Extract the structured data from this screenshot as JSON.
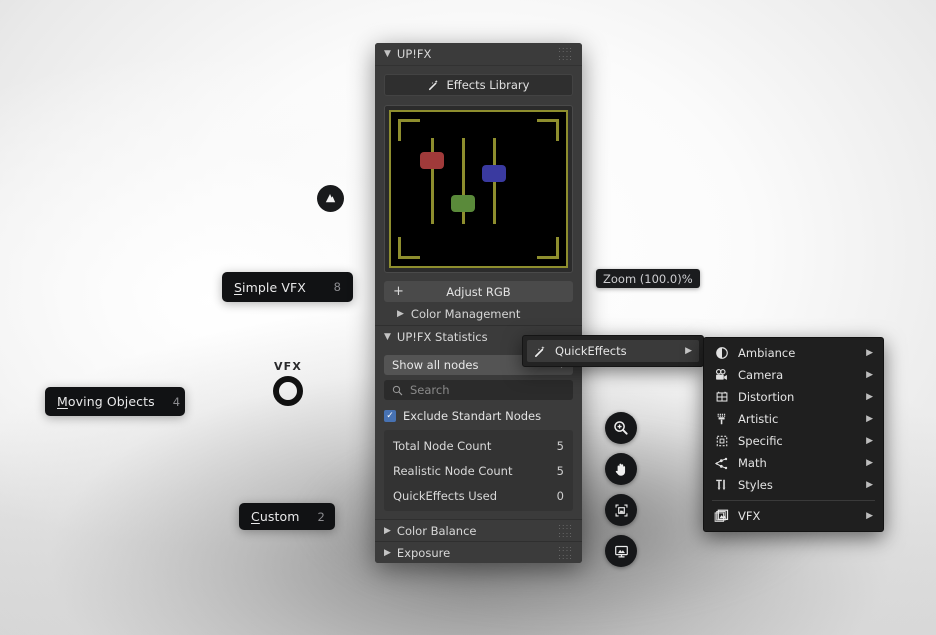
{
  "canvas": {
    "zoom_readout": "Zoom (100.0)%",
    "vfx_marker_label": "VFX"
  },
  "chips": [
    {
      "id": "simple-vfx",
      "accel": "S",
      "rest": "imple VFX",
      "count": "8"
    },
    {
      "id": "moving-objects",
      "accel": "M",
      "rest": "oving Objects",
      "count": "4"
    },
    {
      "id": "custom",
      "accel": "C",
      "rest": "ustom",
      "count": "2"
    }
  ],
  "tool_rail": [
    {
      "name": "zoom-in-icon",
      "title": "Zoom In"
    },
    {
      "name": "pan-hand-icon",
      "title": "Pan"
    },
    {
      "name": "fit-image-icon",
      "title": "Fit Image"
    },
    {
      "name": "display-image-icon",
      "title": "Display"
    }
  ],
  "panel": {
    "title": "UP!FX",
    "effects_library_button": "Effects Library",
    "adjust_rgb_button": "Adjust RGB",
    "color_management_row": "Color Management",
    "statistics": {
      "title": "UP!FX Statistics",
      "filter_selected": "Show all nodes",
      "search_placeholder": "Search",
      "exclude_checkbox_label": "Exclude Standart Nodes",
      "exclude_checked": true,
      "rows": [
        {
          "label": "Total Node Count",
          "value": "5"
        },
        {
          "label": "Realistic Node Count",
          "value": "5"
        },
        {
          "label": "QuickEffects Used",
          "value": "0"
        }
      ]
    },
    "collapsed_sections": [
      {
        "label": "Color Balance"
      },
      {
        "label": "Exposure"
      }
    ],
    "preview": {
      "slider_red_color": "#a03a3a",
      "slider_green_color": "#5a8a3a",
      "slider_blue_color": "#3a3aa0",
      "track_color": "#8e8e2e"
    }
  },
  "context_menu": {
    "items": [
      {
        "label": "QuickEffects",
        "icon": "magic-wand-icon",
        "has_submenu": true
      }
    ]
  },
  "submenu": {
    "items": [
      {
        "label": "Ambiance",
        "icon": "ambiance-icon",
        "has_submenu": true,
        "separator_after": false
      },
      {
        "label": "Camera",
        "icon": "camera-icon",
        "has_submenu": true,
        "separator_after": false
      },
      {
        "label": "Distortion",
        "icon": "distortion-icon",
        "has_submenu": true,
        "separator_after": false
      },
      {
        "label": "Artistic",
        "icon": "artistic-icon",
        "has_submenu": true,
        "separator_after": false
      },
      {
        "label": "Specific",
        "icon": "specific-icon",
        "has_submenu": true,
        "separator_after": false
      },
      {
        "label": "Math",
        "icon": "math-icon",
        "has_submenu": true,
        "separator_after": false
      },
      {
        "label": "Styles",
        "icon": "styles-icon",
        "has_submenu": true,
        "separator_after": true
      },
      {
        "label": "VFX",
        "icon": "vfx-images-icon",
        "has_submenu": true,
        "separator_after": false
      }
    ]
  }
}
